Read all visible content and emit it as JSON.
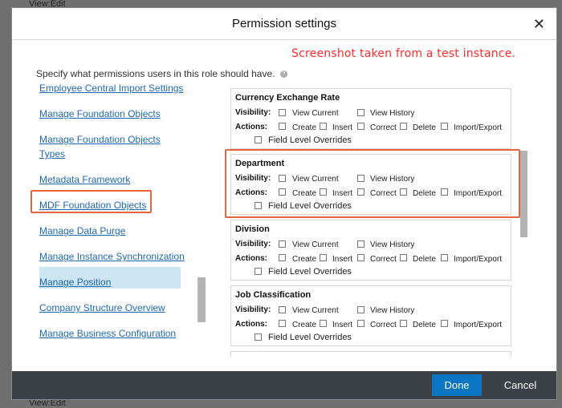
{
  "background": {
    "top_text": "View:Edit",
    "bottom_text": "View:Edit"
  },
  "dialog": {
    "title": "Permission settings",
    "close_label": "✕",
    "annotation": "Screenshot taken from a test instance.",
    "instruction": "Specify what permissions users in this role should have.",
    "help_icon_label": "?"
  },
  "left_list": {
    "items": [
      "Employee Central Import Settings",
      "Manage Foundation Objects",
      "Manage Foundation Objects Types",
      "Metadata Framework",
      "MDF Foundation Objects",
      "Manage Data Purge",
      "Manage Instance Synchronization",
      "Manage Position",
      "Company Structure Overview",
      "Manage Business Configuration"
    ],
    "selected": "MDF Foundation Objects"
  },
  "permissions": {
    "visibility_label": "Visibility:",
    "actions_label": "Actions:",
    "visibility_options": [
      "View Current",
      "View History"
    ],
    "action_options": [
      "Create",
      "Insert",
      "Correct",
      "Delete",
      "Import/Export"
    ],
    "field_level_label": "Field Level Overrides",
    "objects": [
      {
        "name": "Currency Exchange Rate"
      },
      {
        "name": "Department"
      },
      {
        "name": "Division"
      },
      {
        "name": "Job Classification"
      }
    ],
    "highlighted": "Department"
  },
  "footer": {
    "done_label": "Done",
    "cancel_label": "Cancel"
  },
  "colors": {
    "accent": "#0a76c3",
    "link": "#1f68b4",
    "highlight_border": "#e8643c",
    "annotation": "#ff2a2a"
  }
}
